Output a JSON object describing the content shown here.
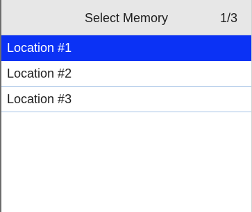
{
  "header": {
    "title": "Select Memory",
    "page_indicator": "1/3"
  },
  "list": {
    "items": [
      {
        "label": "Location #1",
        "selected": true
      },
      {
        "label": "Location #2",
        "selected": false
      },
      {
        "label": "Location #3",
        "selected": false
      }
    ]
  },
  "colors": {
    "selection": "#0b32f5",
    "header_background": "#e7e7e7",
    "row_divider": "#a6c3e6"
  }
}
